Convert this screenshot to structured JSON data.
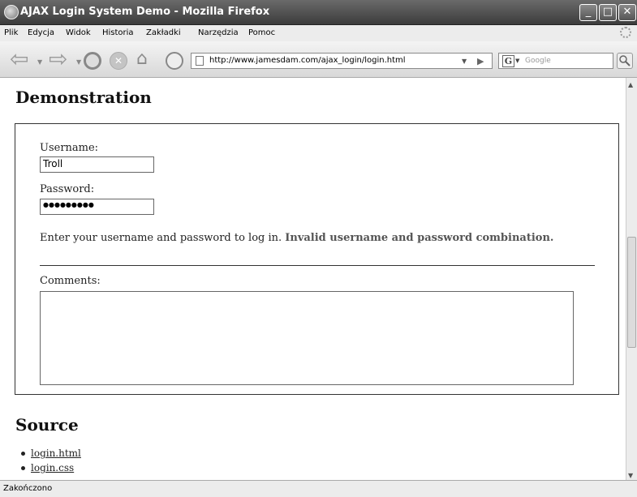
{
  "window": {
    "title": "AJAX Login System Demo - Mozilla Firefox"
  },
  "window_controls": {
    "minimize": "_",
    "maximize": "□",
    "close": "✕"
  },
  "menu": [
    "Plik",
    "Edycja",
    "Widok",
    "Historia",
    "Zakładki",
    "Narzędzia",
    "Pomoc"
  ],
  "toolbar": {
    "url": "http://www.jamesdam.com/ajax_login/login.html",
    "search_placeholder": "Google",
    "search_engine_glyph": "G"
  },
  "page": {
    "demo_heading": "Demonstration",
    "username_label": "Username:",
    "username_value": "Troll",
    "password_label": "Password:",
    "password_value": "●●●●●●●●●",
    "message_prefix": "Enter your username and password to log in.",
    "message_error": "Invalid username and password combination.",
    "comments_label": "Comments:",
    "source_heading": "Source",
    "source_links": [
      "login.html",
      "login.css"
    ]
  },
  "status": {
    "text": "Zakończono"
  },
  "icons": [
    "firefox-icon",
    "back-icon",
    "forward-icon",
    "reload-icon",
    "stop-icon",
    "home-icon",
    "history-icon",
    "page-icon",
    "go-icon",
    "search-icon",
    "throbber-icon"
  ]
}
